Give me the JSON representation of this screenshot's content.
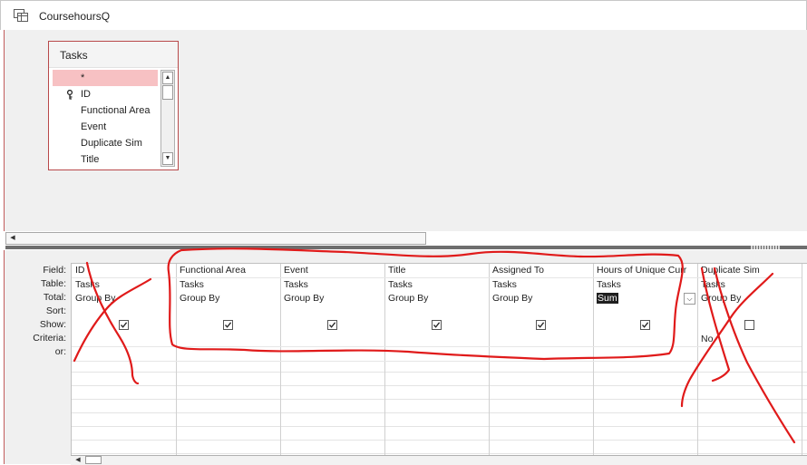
{
  "window": {
    "title": "CoursehoursQ",
    "icon": "query-icon"
  },
  "table_box": {
    "title": "Tasks",
    "fields": [
      "*",
      "ID",
      "Functional Area",
      "Event",
      "Duplicate Sim",
      "Title"
    ],
    "primary_key_field": "ID"
  },
  "design_grid": {
    "row_labels": [
      "Field:",
      "Table:",
      "Total:",
      "Sort:",
      "Show:",
      "Criteria:",
      "or:"
    ],
    "columns": [
      {
        "field": "ID",
        "table": "Tasks",
        "total": "Group By",
        "sort": "",
        "show": true,
        "criteria": ""
      },
      {
        "field": "Functional Area",
        "table": "Tasks",
        "total": "Group By",
        "sort": "",
        "show": true,
        "criteria": ""
      },
      {
        "field": "Event",
        "table": "Tasks",
        "total": "Group By",
        "sort": "",
        "show": true,
        "criteria": ""
      },
      {
        "field": "Title",
        "table": "Tasks",
        "total": "Group By",
        "sort": "",
        "show": true,
        "criteria": ""
      },
      {
        "field": "Assigned To",
        "table": "Tasks",
        "total": "Group By",
        "sort": "",
        "show": true,
        "criteria": ""
      },
      {
        "field": "Hours of Unique Curr",
        "table": "Tasks",
        "total": "Sum",
        "sort": "",
        "show": true,
        "criteria": ""
      },
      {
        "field": "Duplicate Sim",
        "table": "Tasks",
        "total": "Group By",
        "sort": "",
        "show": false,
        "criteria": "No"
      }
    ]
  },
  "colors": {
    "accent": "#b8494a",
    "selected_row": "#f7c1c3",
    "annotation": "#e01a1a"
  }
}
